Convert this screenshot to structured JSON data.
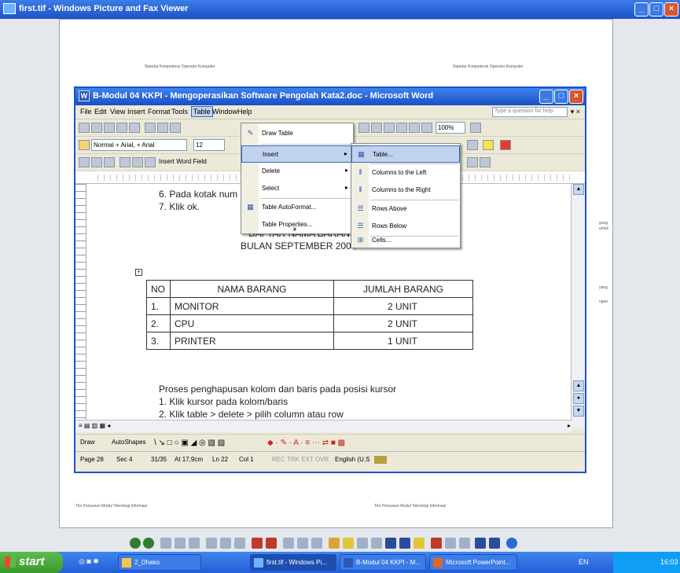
{
  "viewer": {
    "title": "first.tif - Windows Picture and Fax Viewer",
    "header_left": "Standar Kompetensi Operator Komputer",
    "header_right": "Standar Kompetensi Operator Komputer",
    "footer_left": "Tim Penyusun Modul Teknologi Informasi",
    "footer_right": "Tim Penyusun Modul Teknologi Informasi",
    "side_notes": [
      "gung",
      "unluk",
      "yang",
      "ngan"
    ]
  },
  "word": {
    "title": "B-Modul 04 KKPI - Mengoperasikan Software Pengolah Kata2.doc - Microsoft Word",
    "help_placeholder": "Type a question for help",
    "menubar": [
      "File",
      "Edit",
      "View",
      "Insert",
      "Format",
      "Tools",
      "Table",
      "Window",
      "Help"
    ],
    "style_combo": "Normal + Arial, + Arial",
    "font_size": "12",
    "zoom": "100%",
    "insert_word_field": "Insert Word Field",
    "doc_lines": {
      "step6": "6.  Pada kotak num",
      "step7": "7.  Klik ok.",
      "heading1": "DAFTAR NAMA BARANG",
      "heading2": "BULAN SEPTEMBER 2004",
      "para1": "Proses penghapusan kolom dan baris pada posisi kursor",
      "para2": "1. Klik kursor pada kolom/baris",
      "para3": "2. Klik table > delete > pilih column atau row"
    },
    "table": {
      "headers": [
        "NO",
        "NAMA BARANG",
        "JUMLAH BARANG"
      ],
      "rows": [
        [
          "1.",
          "MONITOR",
          "2 UNIT"
        ],
        [
          "2.",
          "CPU",
          "2 UNIT"
        ],
        [
          "3.",
          "PRINTER",
          "1 UNIT"
        ]
      ]
    },
    "table_menu": {
      "items": [
        "Draw Table",
        "Insert",
        "Delete",
        "Select",
        "Table AutoFormat...",
        "Table Properties..."
      ]
    },
    "insert_submenu": {
      "items": [
        "Table...",
        "Columns to the Left",
        "Columns to the Right",
        "Rows Above",
        "Rows Below",
        "Cells..."
      ]
    },
    "drawbar": {
      "draw": "Draw",
      "autoshapes": "AutoShapes"
    },
    "status": {
      "page": "Page 28",
      "sec": "Sec 4",
      "pages": "31/35",
      "at": "At 17,9cm",
      "ln": "Ln 22",
      "col": "Col 1",
      "modes": "REC  TRK  EXT  OVR",
      "lang": "English (U.S"
    }
  },
  "taskbar": {
    "start": "start",
    "tasks": [
      "2_Dhako",
      "first.tif - Windows Pi...",
      "B-Modul 04 KKPI - M...",
      "Microsoft PowerPoint..."
    ],
    "lang": "EN",
    "clock": "16:03"
  }
}
